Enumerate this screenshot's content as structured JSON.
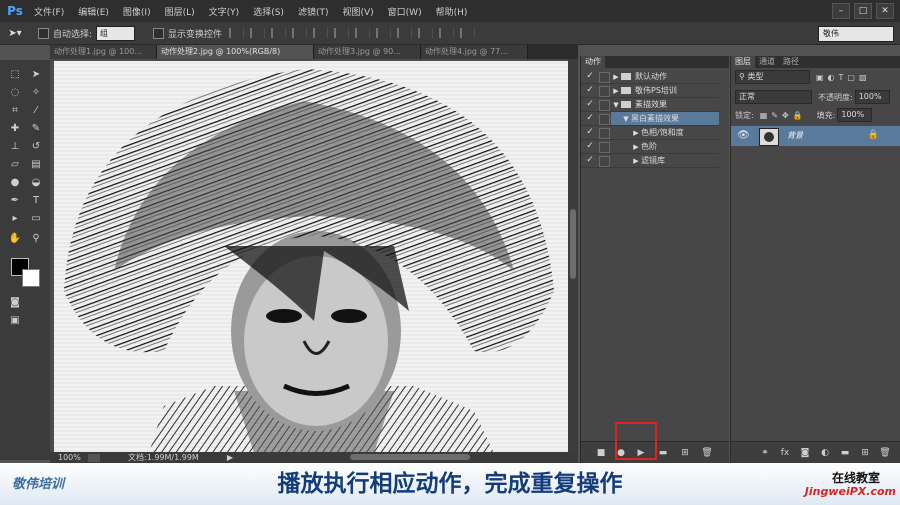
{
  "menubar": {
    "logo": "Ps",
    "items": [
      "文件(F)",
      "编辑(E)",
      "图像(I)",
      "图层(L)",
      "文字(Y)",
      "选择(S)",
      "滤镜(T)",
      "视图(V)",
      "窗口(W)",
      "帮助(H)"
    ],
    "controls": [
      "–",
      "□",
      "✕"
    ]
  },
  "optionsbar": {
    "auto_select_label": "自动选择:",
    "auto_select_value": "组",
    "show_transform_label": "显示变换控件",
    "workspace": "敬伟"
  },
  "tabs": [
    {
      "label": "动作处理1.jpg @ 100...",
      "active": false
    },
    {
      "label": "动作处理2.jpg @ 100%(RGB/8)",
      "active": true
    },
    {
      "label": "动作处理3.jpg @ 90...",
      "active": false
    },
    {
      "label": "动作处理4.jpg @ 77...",
      "active": false
    }
  ],
  "statusbar": {
    "zoom": "100%",
    "doc_info": "文档:1.99M/1.99M",
    "arrow": "▶"
  },
  "actions_panel": {
    "tab": "动作",
    "rows": [
      {
        "check": "✓",
        "expanded": false,
        "folder": true,
        "label": "默认动作",
        "indent": 0,
        "selected": false
      },
      {
        "check": "✓",
        "expanded": false,
        "folder": true,
        "label": "敬伟PS培训",
        "indent": 0,
        "selected": false
      },
      {
        "check": "✓",
        "expanded": true,
        "folder": true,
        "label": "素描效果",
        "indent": 0,
        "selected": false
      },
      {
        "check": "✓",
        "expanded": true,
        "folder": false,
        "label": "黑白素描效果",
        "indent": 1,
        "selected": true
      },
      {
        "check": "✓",
        "expanded": false,
        "folder": false,
        "label": "色相/饱和度",
        "indent": 2,
        "selected": false
      },
      {
        "check": "✓",
        "expanded": false,
        "folder": false,
        "label": "色阶",
        "indent": 2,
        "selected": false
      },
      {
        "check": "✓",
        "expanded": false,
        "folder": false,
        "label": "滤镜库",
        "indent": 2,
        "selected": false
      }
    ]
  },
  "layers_panel": {
    "tabs": [
      "图层",
      "通道",
      "路径"
    ],
    "filter_kind": "类型",
    "blend_mode": "正常",
    "opacity_label": "不透明度:",
    "opacity_value": "100%",
    "lock_label": "锁定:",
    "fill_label": "填充:",
    "fill_value": "100%",
    "layer_name": "背景"
  },
  "subtitle": {
    "brand_left": "敬伟培训",
    "text": "播放执行相应动作，完成重复操作",
    "brand_right_1": "在线教室",
    "brand_right_2": "JingweiPX.com"
  },
  "colors": {
    "accent": "#5a7a9c",
    "highlight": "#e02222",
    "subtitle": "#123d7a"
  }
}
